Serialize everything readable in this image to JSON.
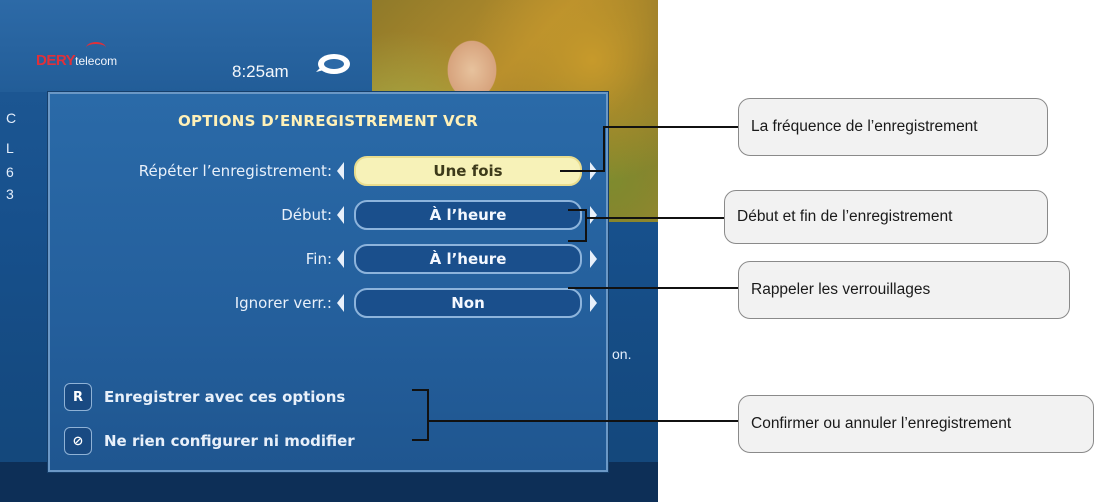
{
  "header": {
    "logo_primary": "DERY",
    "logo_secondary": "telecom",
    "time": "8:25am"
  },
  "background_fragments": [
    "C",
    "L",
    "6",
    "3",
    "on."
  ],
  "dialog": {
    "title": "OPTIONS D’ENREGISTREMENT VCR",
    "rows": [
      {
        "label": "Répéter l’enregistrement:",
        "value": "Une fois",
        "state": "selected"
      },
      {
        "label": "Début:",
        "value": "À l’heure",
        "state": "normal"
      },
      {
        "label": "Fin:",
        "value": "À l’heure",
        "state": "normal"
      },
      {
        "label": "Ignorer verr.:",
        "value": "Non",
        "state": "normal"
      }
    ],
    "actions": [
      {
        "icon": "record-icon",
        "icon_glyph": "R",
        "label": "Enregistrer avec ces options"
      },
      {
        "icon": "cancel-icon",
        "icon_glyph": "⊘",
        "label": "Ne rien configurer ni modifier"
      }
    ]
  },
  "callouts": [
    "La fréquence de l’enregistrement",
    "Début et fin de l’enregistrement",
    "Rappeler les verrouillages",
    "Confirmer ou annuler l’enregistrement"
  ],
  "colors": {
    "panel": "#245f9c",
    "title_text": "#fff1b8",
    "selected_pill": "#f7f2b8",
    "logo_red": "#e0303a"
  }
}
